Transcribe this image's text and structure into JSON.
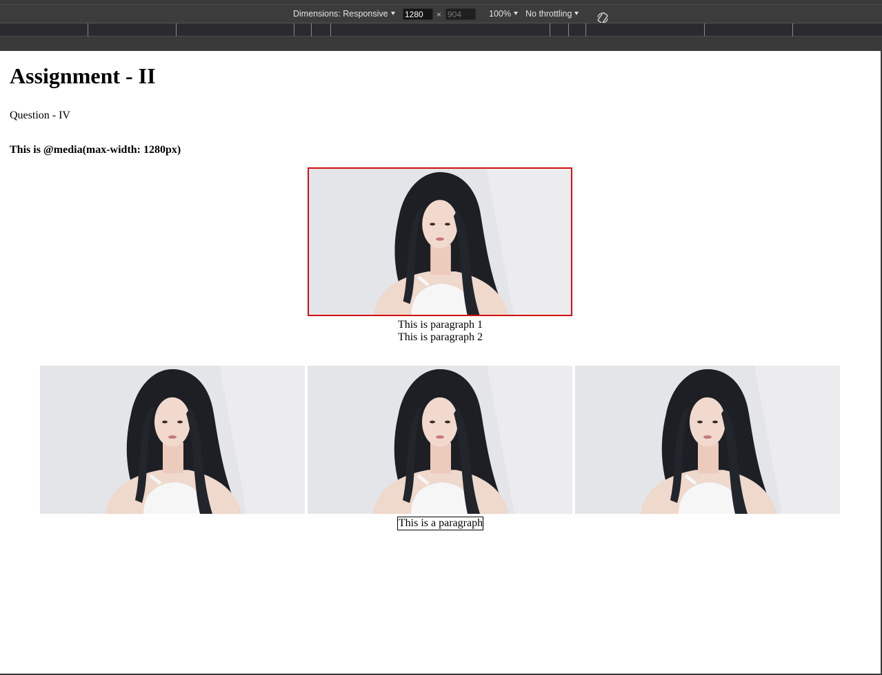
{
  "devtools": {
    "dimensions_label": "Dimensions: Responsive",
    "width_value": "1280",
    "height_placeholder": "904",
    "times": "×",
    "zoom_label": "100%",
    "throttling_label": "No throttling",
    "icons": {
      "rotate": "rotate-icon",
      "caret": "chevron-down-icon"
    }
  },
  "page": {
    "title": "Assignment - II",
    "question": "Question - IV",
    "media_note": "This is @media(max-width: 1280px)",
    "paragraph_1": "This is paragraph 1",
    "paragraph_2": "This is paragraph 2",
    "boxed_paragraph": "This is a paragraph"
  },
  "colors": {
    "devtools_bg": "#3c3c3c",
    "main_image_border": "#d10f0f"
  }
}
